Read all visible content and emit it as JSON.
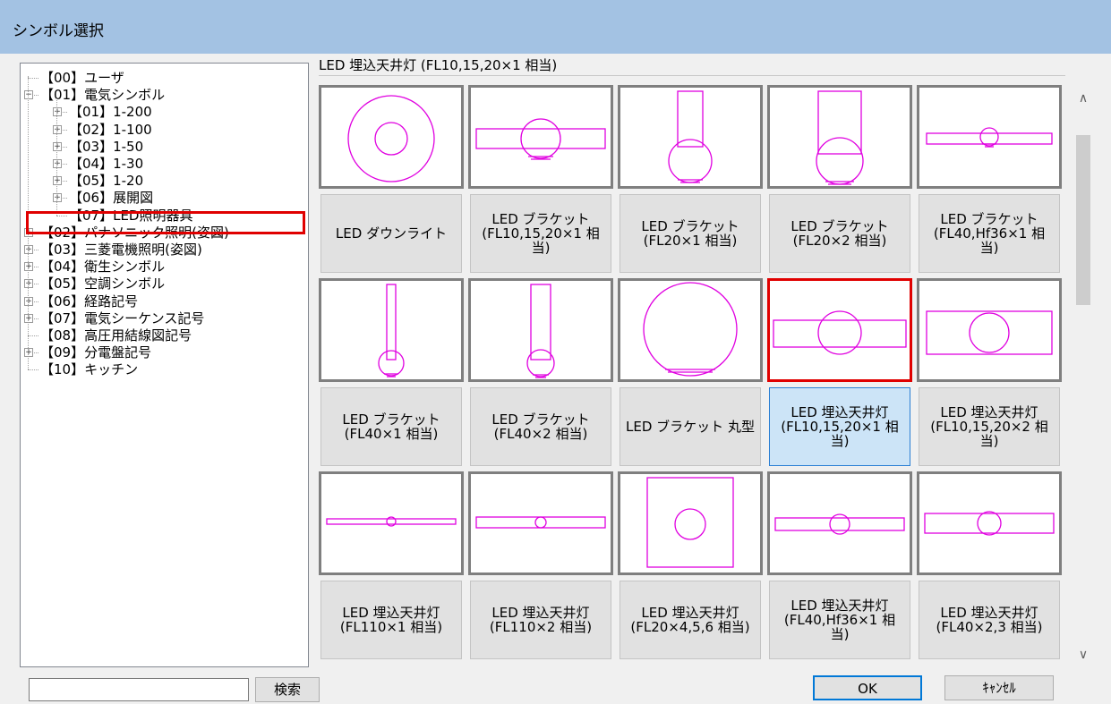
{
  "window": {
    "title": "シンボル選択"
  },
  "tree": {
    "items": [
      {
        "label": "【00】ユーザ",
        "level": 0,
        "expander": "none"
      },
      {
        "label": "【01】電気シンボル",
        "level": 0,
        "expander": "minus"
      },
      {
        "label": "【01】1-200",
        "level": 1,
        "expander": "plus"
      },
      {
        "label": "【02】1-100",
        "level": 1,
        "expander": "plus"
      },
      {
        "label": "【03】1-50",
        "level": 1,
        "expander": "plus"
      },
      {
        "label": "【04】1-30",
        "level": 1,
        "expander": "plus"
      },
      {
        "label": "【05】1-20",
        "level": 1,
        "expander": "plus"
      },
      {
        "label": "【06】展開図",
        "level": 1,
        "expander": "plus"
      },
      {
        "label": "【07】LED照明器具",
        "level": 1,
        "expander": "none",
        "selected": true
      },
      {
        "label": "【02】パナソニック照明(姿図)",
        "level": 0,
        "expander": "plus"
      },
      {
        "label": "【03】三菱電機照明(姿図)",
        "level": 0,
        "expander": "plus"
      },
      {
        "label": "【04】衛生シンボル",
        "level": 0,
        "expander": "plus"
      },
      {
        "label": "【05】空調シンボル",
        "level": 0,
        "expander": "plus"
      },
      {
        "label": "【06】経路記号",
        "level": 0,
        "expander": "plus"
      },
      {
        "label": "【07】電気シーケンス記号",
        "level": 0,
        "expander": "plus"
      },
      {
        "label": "【08】高圧用結線図記号",
        "level": 0,
        "expander": "none"
      },
      {
        "label": "【09】分電盤記号",
        "level": 0,
        "expander": "plus"
      },
      {
        "label": "【10】キッチン",
        "level": 0,
        "expander": "none"
      }
    ]
  },
  "selected_symbol_label": "LED 埋込天井灯 (FL10,15,20×1 相当)",
  "symbols": [
    {
      "caption": "LED ダウンライト",
      "shape": "downlight"
    },
    {
      "caption": "LED ブラケット\n(FL10,15,20×1 相\n当)",
      "shape": "bracket-horizontal"
    },
    {
      "caption": "LED ブラケット\n(FL20×1 相当)",
      "shape": "bracket-vertical-narrow"
    },
    {
      "caption": "LED ブラケット\n(FL20×2 相当)",
      "shape": "bracket-vertical-wide"
    },
    {
      "caption": "LED ブラケット\n(FL40,Hf36×1 相\n当)",
      "shape": "bracket-horizontal-long"
    },
    {
      "caption": "LED ブラケット\n(FL40×1 相当)",
      "shape": "bracket-vertical-long-narrow"
    },
    {
      "caption": "LED ブラケット\n(FL40×2 相当)",
      "shape": "bracket-vertical-long-wide"
    },
    {
      "caption": "LED ブラケット 丸型",
      "shape": "bracket-round"
    },
    {
      "caption": "LED 埋込天井灯\n(FL10,15,20×1 相\n当)",
      "shape": "recessed-1",
      "selected": true
    },
    {
      "caption": "LED 埋込天井灯\n(FL10,15,20×2 相\n当)",
      "shape": "recessed-2"
    },
    {
      "caption": "LED 埋込天井灯\n(FL110×1 相当)",
      "shape": "recessed-long-1"
    },
    {
      "caption": "LED 埋込天井灯\n(FL110×2 相当)",
      "shape": "recessed-long-2"
    },
    {
      "caption": "LED 埋込天井灯\n(FL20×4,5,6 相当)",
      "shape": "recessed-square"
    },
    {
      "caption": "LED 埋込天井灯\n(FL40,Hf36×1 相\n当)",
      "shape": "recessed-40-1"
    },
    {
      "caption": "LED 埋込天井灯\n(FL40×2,3 相当)",
      "shape": "recessed-40-23"
    }
  ],
  "symbol_color": "#e000e0",
  "search": {
    "button_label": "検索",
    "value": ""
  },
  "buttons": {
    "ok": "OK",
    "cancel": "ｷｬﾝｾﾙ"
  },
  "scroll": {
    "up_icon": "chevron-up-icon",
    "down_icon": "chevron-down-icon"
  }
}
